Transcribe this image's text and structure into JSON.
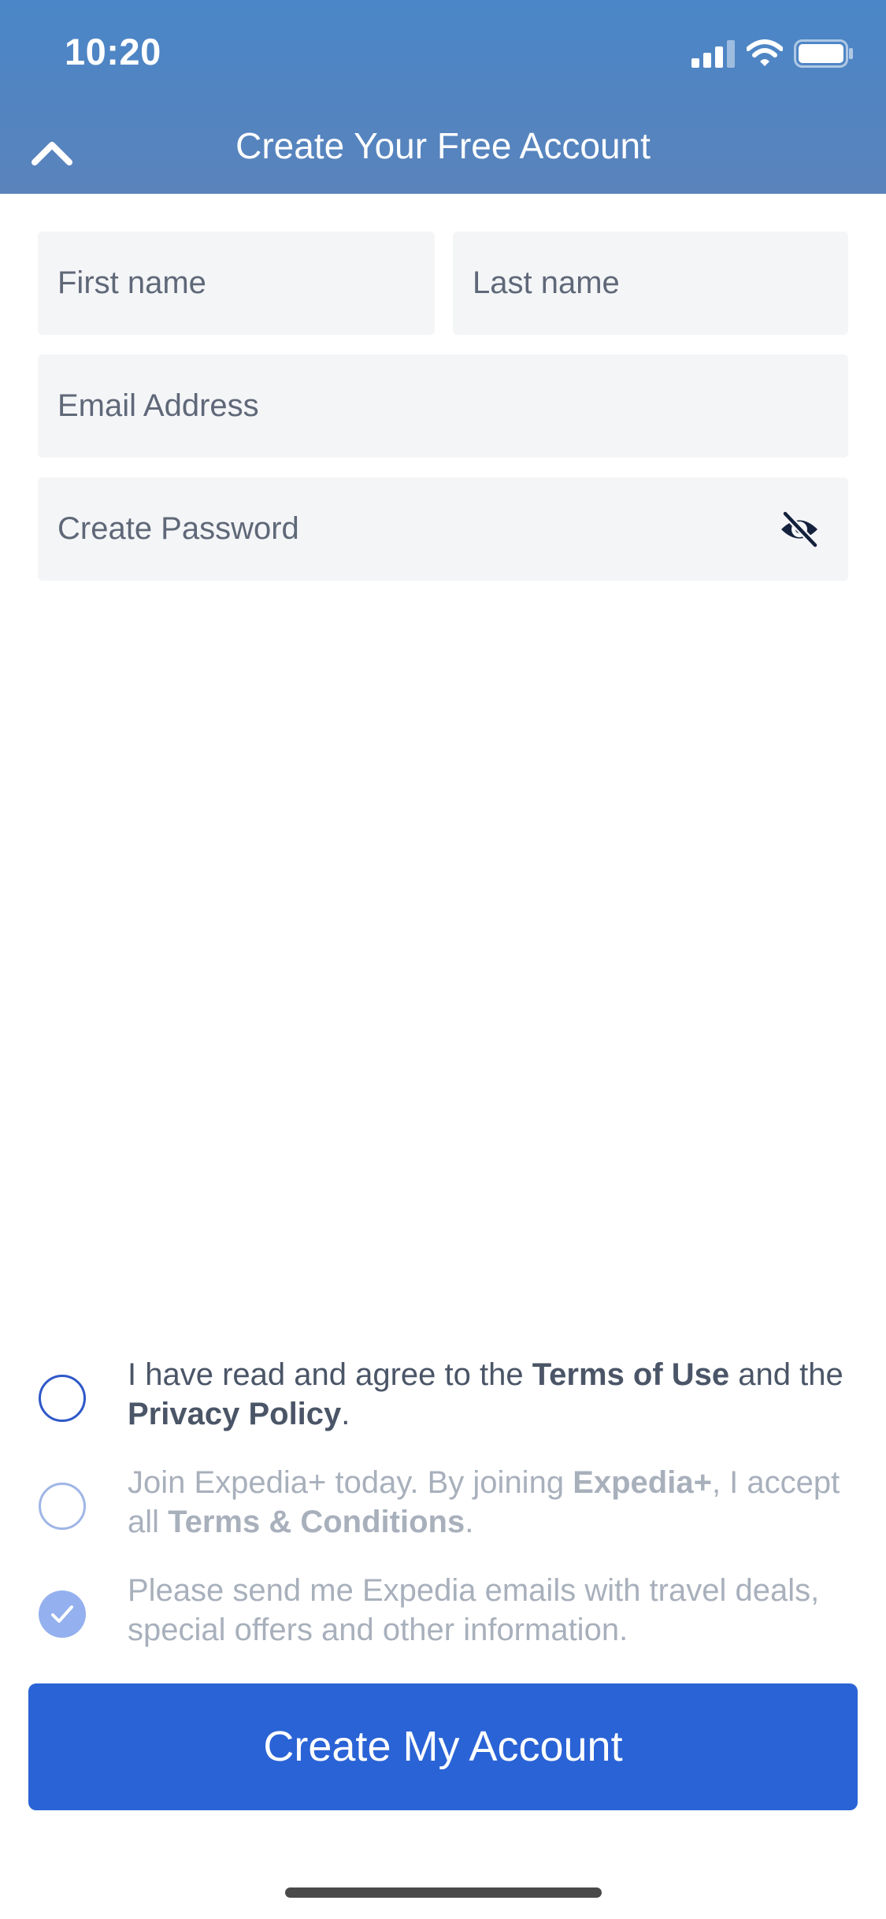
{
  "status_bar": {
    "time": "10:20",
    "icons": [
      "signal-icon",
      "wifi-icon",
      "battery-icon"
    ]
  },
  "header": {
    "title": "Create Your Free Account",
    "collapse_icon": "chevron-up-icon",
    "background": "#4a86c8"
  },
  "form": {
    "first_name": {
      "placeholder": "First name",
      "value": ""
    },
    "last_name": {
      "placeholder": "Last name",
      "value": ""
    },
    "email": {
      "placeholder": "Email Address",
      "value": ""
    },
    "password": {
      "placeholder": "Create Password",
      "value": "",
      "toggle_icon": "eye-slash-icon"
    }
  },
  "agreements": {
    "terms": {
      "checked": false,
      "text_1": "I have read and agree to the ",
      "link_1": "Terms of Use",
      "text_2": " and the ",
      "link_2": "Privacy Policy",
      "text_3": "."
    },
    "loyalty": {
      "checked": false,
      "text_1": "Join Expedia+ today. By joining ",
      "link_1": "Expedia+",
      "text_2": ", I accept all ",
      "link_2": "Terms & Conditions",
      "text_3": "."
    },
    "emails": {
      "checked": true,
      "text": "Please send me Expedia emails with travel deals, special offers and other information."
    }
  },
  "submit": {
    "label": "Create My Account",
    "color": "#2a63d6"
  }
}
